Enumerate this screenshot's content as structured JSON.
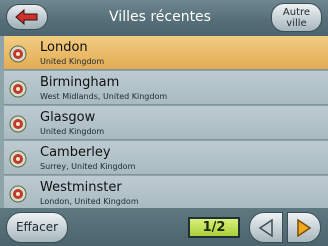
{
  "header": {
    "title": "Villes récentes",
    "new_city_line1": "Autre",
    "new_city_line2": "ville"
  },
  "list": [
    {
      "name": "London",
      "sub": "United Kingdom",
      "selected": true
    },
    {
      "name": "Birmingham",
      "sub": "West Midlands, United Kingdom",
      "selected": false
    },
    {
      "name": "Glasgow",
      "sub": "United Kingdom",
      "selected": false
    },
    {
      "name": "Camberley",
      "sub": "Surrey, United Kingdom",
      "selected": false
    },
    {
      "name": "Westminster",
      "sub": "London, United Kingdom",
      "selected": false
    }
  ],
  "footer": {
    "clear_label": "Effacer",
    "page": "1/2"
  },
  "colors": {
    "selected_row": "#e8b45c",
    "row": "#b3c3c9",
    "page_indicator": "#b9d94a",
    "back_arrow": "#d0312d",
    "next_arrow": "#f0a81c"
  },
  "icons": {
    "back": "back-arrow-icon",
    "location": "location-pin-icon",
    "prev": "triangle-left-icon",
    "next": "triangle-right-icon"
  }
}
